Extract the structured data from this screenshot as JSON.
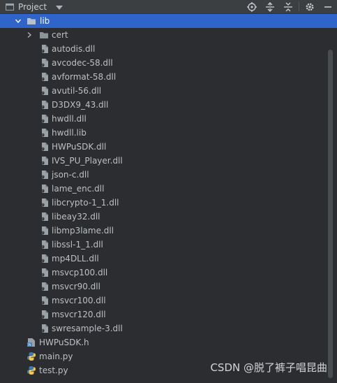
{
  "header": {
    "title": "Project",
    "dropdown_icon": "chevron-down-icon",
    "toolbar": [
      {
        "name": "select-opened-file-icon"
      },
      {
        "name": "expand-all-icon"
      },
      {
        "name": "collapse-all-icon"
      },
      {
        "name": "gear-icon"
      },
      {
        "name": "minimize-icon"
      }
    ]
  },
  "tree": {
    "lib_folder": "lib",
    "cert_folder": "cert",
    "lib_files": [
      "autodis.dll",
      "avcodec-58.dll",
      "avformat-58.dll",
      "avutil-56.dll",
      "D3DX9_43.dll",
      "hwdll.dll",
      "hwdll.lib",
      "HWPuSDK.dll",
      "IVS_PU_Player.dll",
      "json-c.dll",
      "lame_enc.dll",
      "libcrypto-1_1.dll",
      "libeay32.dll",
      "libmp3lame.dll",
      "libssl-1_1.dll",
      "mp4DLL.dll",
      "msvcp100.dll",
      "msvcr90.dll",
      "msvcr100.dll",
      "msvcr120.dll",
      "swresample-3.dll"
    ],
    "root_files": [
      {
        "label": "HWPuSDK.h",
        "type": "header"
      },
      {
        "label": "main.py",
        "type": "python"
      },
      {
        "label": "test.py",
        "type": "python"
      }
    ]
  },
  "watermark": "CSDN @脱了裤子唱昆曲",
  "colors": {
    "background": "#2b2d30",
    "header": "#3c3f41",
    "selection": "#2f65ca",
    "folder": "#8d9499",
    "text": "#bcc0c4"
  }
}
